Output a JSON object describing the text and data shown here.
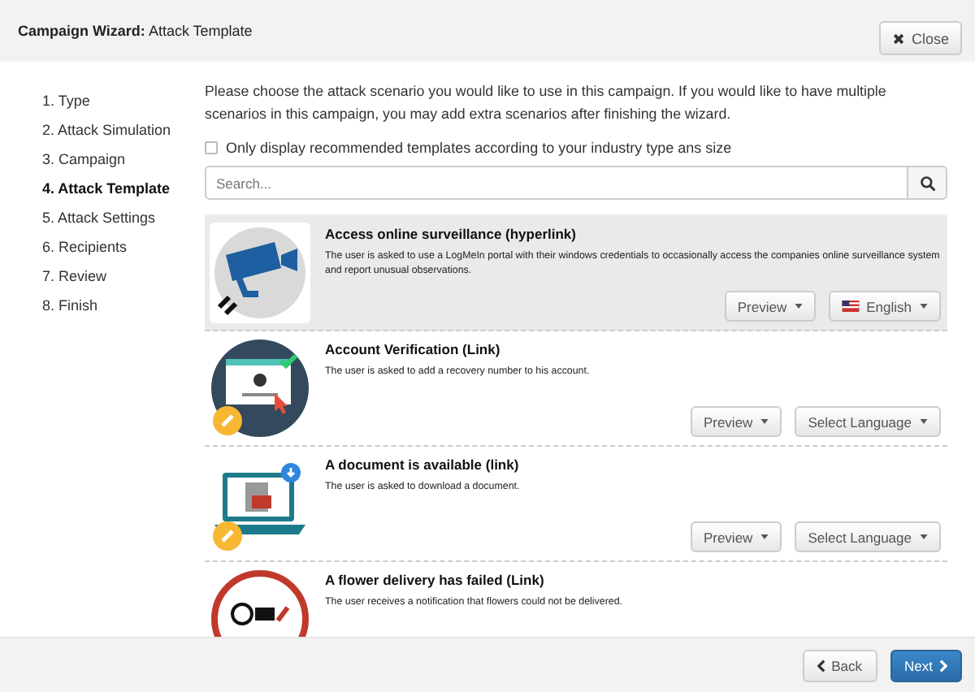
{
  "window": {
    "title_bold": "Campaign Wizard:",
    "title": "Attack Template",
    "close_label": "Close"
  },
  "steps": [
    {
      "label": "1. Type",
      "selected": false
    },
    {
      "label": "2. Attack Simulation",
      "selected": false
    },
    {
      "label": "3. Campaign",
      "selected": false
    },
    {
      "label": "4. Attack Template",
      "selected": true
    },
    {
      "label": "5. Attack Settings",
      "selected": false
    },
    {
      "label": "6. Recipients",
      "selected": false
    },
    {
      "label": "7. Review",
      "selected": false
    },
    {
      "label": "8. Finish",
      "selected": false
    }
  ],
  "intro": "Please choose the attack scenario you would like to use in this campaign. If you would like to have multiple scenarios in this campaign, you may add extra scenarios after finishing the wizard.",
  "recommended_filter": {
    "label": "Only display recommended templates according to your industry type ans size",
    "checked": false
  },
  "search": {
    "placeholder": "Search..."
  },
  "templates": [
    {
      "kind": "camera",
      "title": "Access online surveillance (hyperlink)",
      "description": "The user is asked to use a LogMeIn portal with their windows credentials to occasionally access the companies online surveillance system and report unusual observations.",
      "selected": true,
      "preview_label": "Preview",
      "language": {
        "label": "English",
        "flag": true
      }
    },
    {
      "kind": "account",
      "title": "Account Verification (Link)",
      "description": "The user is asked to add a recovery number to his account.",
      "selected": false,
      "preview_label": "Preview",
      "language": {
        "label": "Select Language",
        "flag": false
      }
    },
    {
      "kind": "laptop",
      "title": "A document is available (link)",
      "description": "The user is asked to download a document.",
      "selected": false,
      "preview_label": "Preview",
      "language": {
        "label": "Select Language",
        "flag": false
      }
    },
    {
      "kind": "flower",
      "title": "A flower delivery has failed (Link)",
      "description": "The user receives a notification that flowers could not be delivered.",
      "selected": false
    }
  ],
  "footer": {
    "back_label": "Back",
    "next_label": "Next"
  }
}
